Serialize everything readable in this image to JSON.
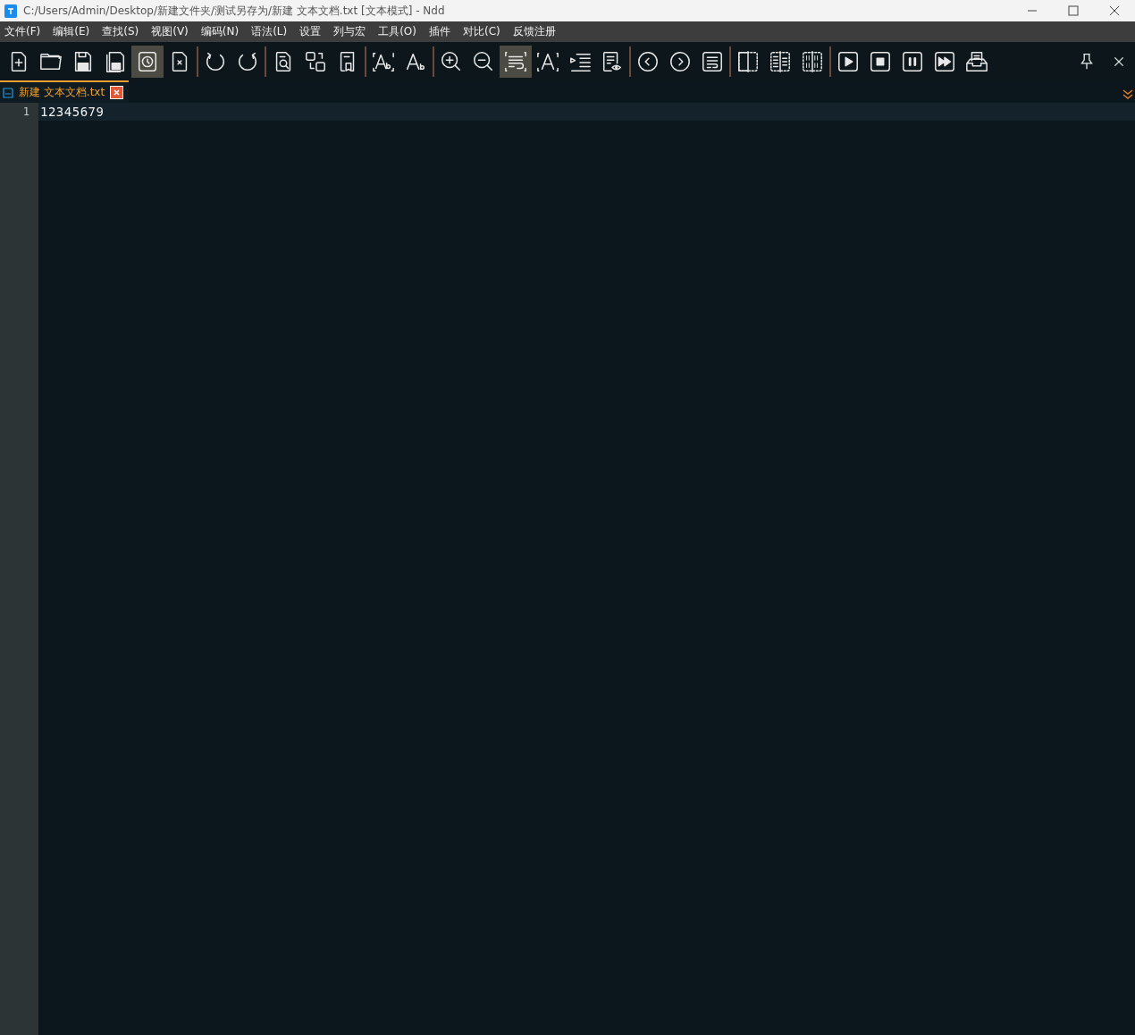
{
  "window": {
    "title": "C:/Users/Admin/Desktop/新建文件夹/测试另存为/新建 文本文档.txt [文本模式] - Ndd"
  },
  "menu": [
    "文件(F)",
    "编辑(E)",
    "查找(S)",
    "视图(V)",
    "编码(N)",
    "语法(L)",
    "设置",
    "列与宏",
    "工具(O)",
    "插件",
    "对比(C)",
    "反馈注册"
  ],
  "toolbar": {
    "groups": [
      [
        {
          "on": false
        },
        {
          "on": false
        },
        {
          "on": false
        },
        {
          "on": false
        },
        {
          "on": true
        },
        {
          "on": false
        }
      ],
      [
        {
          "on": false
        },
        {
          "on": false
        }
      ],
      [
        {
          "on": false
        },
        {
          "on": false
        },
        {
          "on": false
        }
      ],
      [
        {
          "on": false
        },
        {
          "on": false
        }
      ],
      [
        {
          "on": false
        },
        {
          "on": false
        },
        {
          "on": true
        },
        {
          "on": false
        },
        {
          "on": false
        },
        {
          "on": false
        }
      ],
      [
        {
          "on": false
        },
        {
          "on": false
        },
        {
          "on": false
        }
      ],
      [
        {
          "on": false
        },
        {
          "on": false
        },
        {
          "on": false
        }
      ],
      [
        {
          "on": false
        },
        {
          "on": false
        },
        {
          "on": false
        },
        {
          "on": false
        },
        {
          "on": false
        }
      ]
    ]
  },
  "tabs": [
    {
      "label": "新建 文本文档.txt",
      "selected": true
    }
  ],
  "editor": {
    "lines": [
      {
        "number": "1",
        "text": "12345679",
        "current": true
      }
    ]
  }
}
